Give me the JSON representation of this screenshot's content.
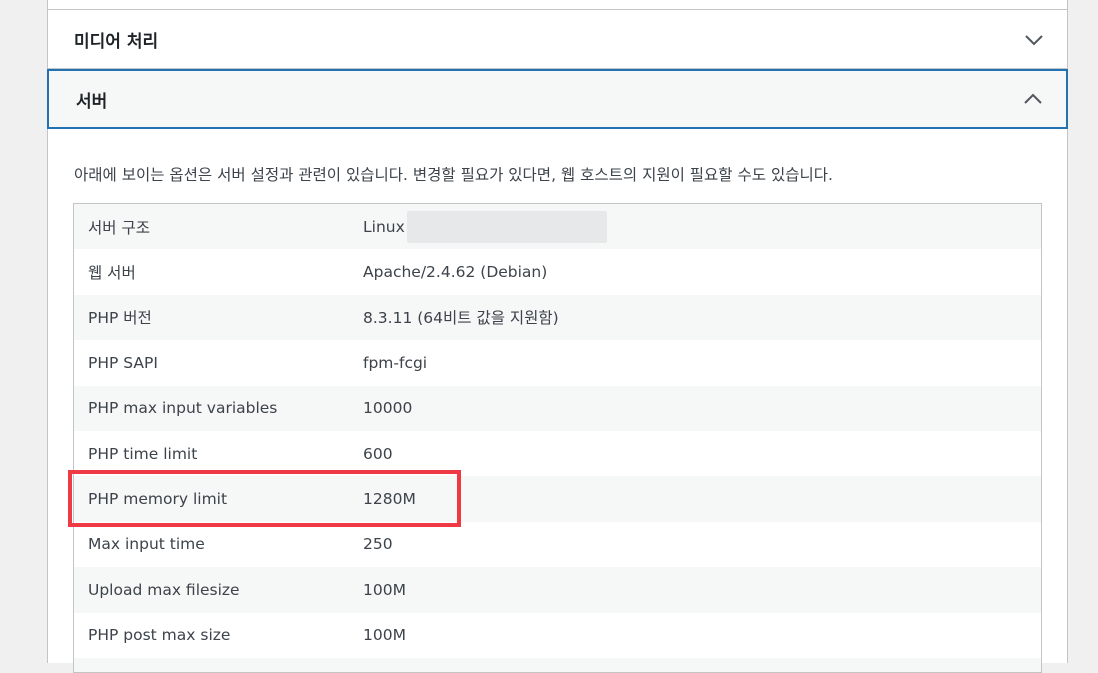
{
  "sections": {
    "media": {
      "title": "미디어 처리"
    },
    "server": {
      "title": "서버"
    }
  },
  "description": "아래에 보이는 옵션은 서버 설정과 관련이 있습니다. 변경할 필요가 있다면, 웹 호스트의 지원이 필요할 수도 있습니다.",
  "rows": [
    {
      "label": "서버 구조",
      "value": "Linux"
    },
    {
      "label": "웹 서버",
      "value": "Apache/2.4.62 (Debian)"
    },
    {
      "label": "PHP 버전",
      "value": "8.3.11 (64비트 값을 지원함)"
    },
    {
      "label": "PHP SAPI",
      "value": "fpm-fcgi"
    },
    {
      "label": "PHP max input variables",
      "value": "10000"
    },
    {
      "label": "PHP time limit",
      "value": "600"
    },
    {
      "label": "PHP memory limit",
      "value": "1280M"
    },
    {
      "label": "Max input time",
      "value": "250"
    },
    {
      "label": "Upload max filesize",
      "value": "100M"
    },
    {
      "label": "PHP post max size",
      "value": "100M"
    },
    {
      "label": "",
      "value": ""
    }
  ],
  "colors": {
    "accent": "#2271b1",
    "highlight": "#ef3a45"
  }
}
